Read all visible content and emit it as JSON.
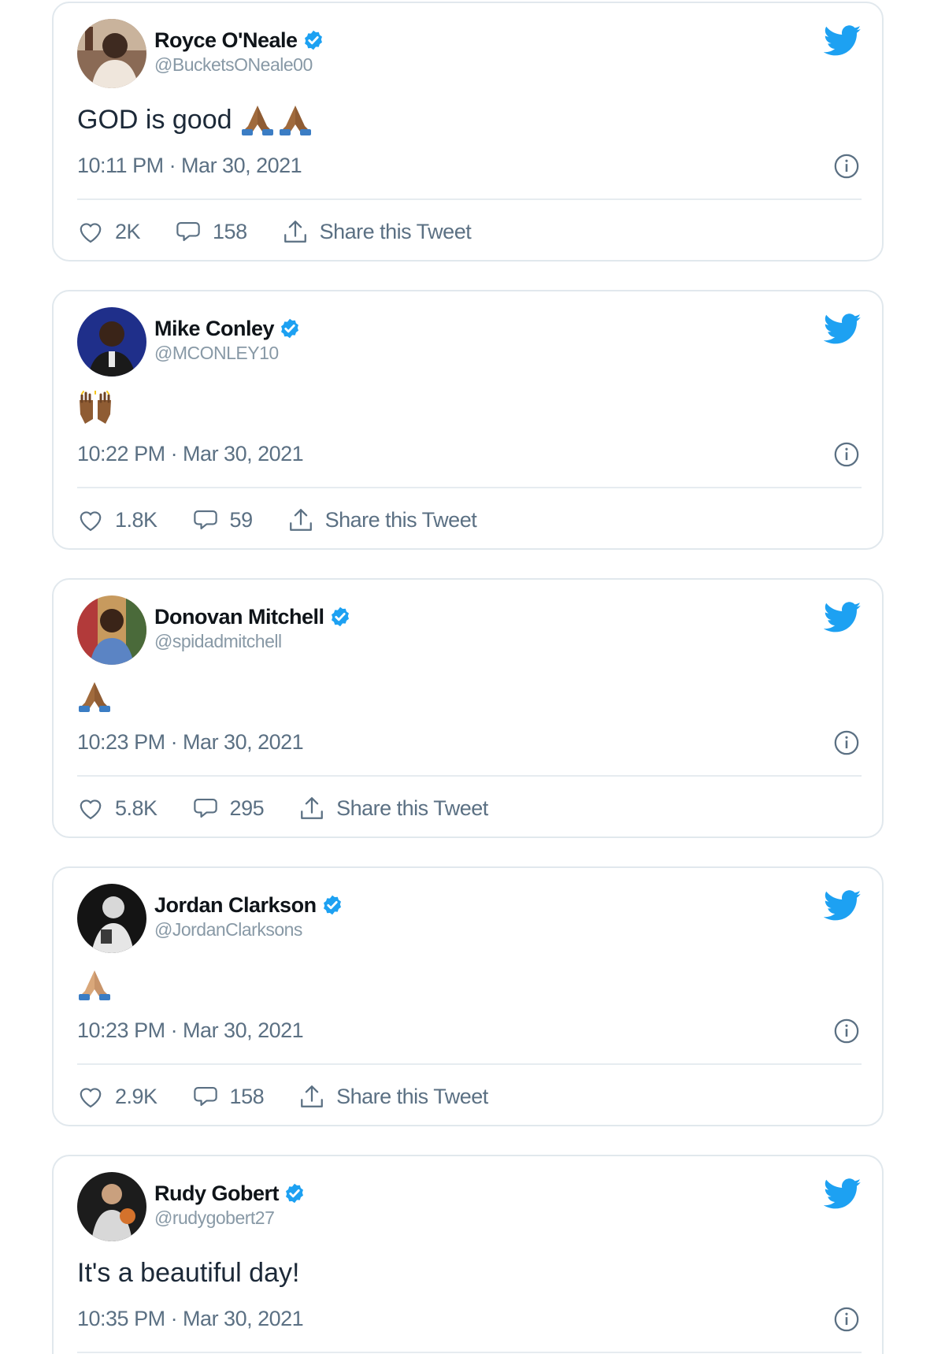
{
  "accent_color": "#1da1f2",
  "labels": {
    "share": "Share this Tweet"
  },
  "tweets": [
    {
      "name": "Royce O'Neale",
      "handle": "@BucketsONeale00",
      "text": "GOD is good",
      "emoji": [
        "folded-hands",
        "folded-hands"
      ],
      "time": "10:11 PM · Mar 30, 2021",
      "likes": "2K",
      "replies": "158"
    },
    {
      "name": "Mike Conley",
      "handle": "@MCONLEY10",
      "text": "",
      "emoji": [
        "raising-hands"
      ],
      "time": "10:22 PM · Mar 30, 2021",
      "likes": "1.8K",
      "replies": "59"
    },
    {
      "name": "Donovan Mitchell",
      "handle": "@spidadmitchell",
      "text": "",
      "emoji": [
        "folded-hands"
      ],
      "time": "10:23 PM · Mar 30, 2021",
      "likes": "5.8K",
      "replies": "295"
    },
    {
      "name": "Jordan Clarkson",
      "handle": "@JordanClarksons",
      "text": "",
      "emoji": [
        "folded-hands"
      ],
      "time": "10:23 PM · Mar 30, 2021",
      "likes": "2.9K",
      "replies": "158"
    },
    {
      "name": "Rudy Gobert",
      "handle": "@rudygobert27",
      "text": "It's a beautiful day!",
      "emoji": [],
      "time": "10:35 PM · Mar 30, 2021"
    }
  ]
}
